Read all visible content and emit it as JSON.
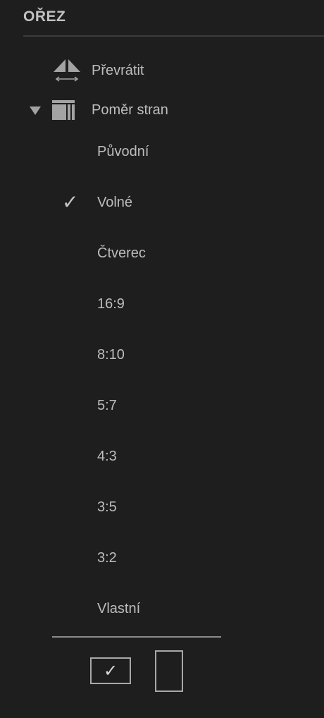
{
  "panel": {
    "title": "OŘEZ"
  },
  "flip": {
    "label": "Převrátit",
    "icon": "flip-icon"
  },
  "aspect": {
    "label": "Poměr stran",
    "icon": "aspect-ratio-icon",
    "expanded": true,
    "selected": "Volné",
    "options": [
      {
        "label": "Původní",
        "checked": false
      },
      {
        "label": "Volné",
        "checked": true
      },
      {
        "label": "Čtverec",
        "checked": false
      },
      {
        "label": "16:9",
        "checked": false
      },
      {
        "label": "8:10",
        "checked": false
      },
      {
        "label": "5:7",
        "checked": false
      },
      {
        "label": "4:3",
        "checked": false
      },
      {
        "label": "3:5",
        "checked": false
      },
      {
        "label": "3:2",
        "checked": false
      },
      {
        "label": "Vlastní",
        "checked": false
      }
    ]
  },
  "actions": {
    "confirm_icon": "checkmark-icon",
    "check_glyph": "✓",
    "orientation_icon": "portrait-orientation-icon"
  },
  "colors": {
    "background": "#1e1e1e",
    "text": "#bdbdbd",
    "icon": "#9a9a9a"
  }
}
